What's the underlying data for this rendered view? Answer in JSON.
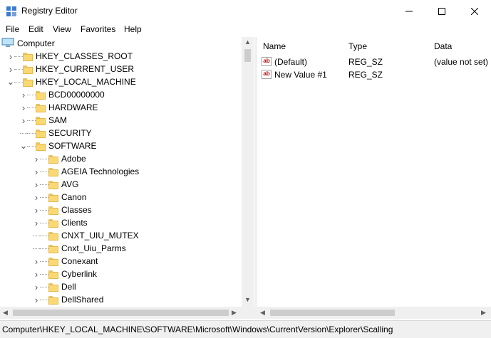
{
  "window": {
    "title": "Registry Editor"
  },
  "menu": [
    "File",
    "Edit",
    "View",
    "Favorites",
    "Help"
  ],
  "tree": [
    {
      "label": "Computer",
      "level": 0,
      "expander": "none",
      "icon": "computer-icon"
    },
    {
      "label": "HKEY_CLASSES_ROOT",
      "level": 1,
      "expander": "collapsed"
    },
    {
      "label": "HKEY_CURRENT_USER",
      "level": 1,
      "expander": "collapsed"
    },
    {
      "label": "HKEY_LOCAL_MACHINE",
      "level": 1,
      "expander": "expanded"
    },
    {
      "label": "BCD00000000",
      "level": 2,
      "expander": "collapsed"
    },
    {
      "label": "HARDWARE",
      "level": 2,
      "expander": "collapsed"
    },
    {
      "label": "SAM",
      "level": 2,
      "expander": "collapsed"
    },
    {
      "label": "SECURITY",
      "level": 2,
      "expander": "none"
    },
    {
      "label": "SOFTWARE",
      "level": 2,
      "expander": "expanded"
    },
    {
      "label": "Adobe",
      "level": 3,
      "expander": "collapsed"
    },
    {
      "label": "AGEIA Technologies",
      "level": 3,
      "expander": "collapsed"
    },
    {
      "label": "AVG",
      "level": 3,
      "expander": "collapsed"
    },
    {
      "label": "Canon",
      "level": 3,
      "expander": "collapsed"
    },
    {
      "label": "Classes",
      "level": 3,
      "expander": "collapsed"
    },
    {
      "label": "Clients",
      "level": 3,
      "expander": "collapsed"
    },
    {
      "label": "CNXT_UIU_MUTEX",
      "level": 3,
      "expander": "none"
    },
    {
      "label": "Cnxt_Uiu_Parms",
      "level": 3,
      "expander": "none"
    },
    {
      "label": "Conexant",
      "level": 3,
      "expander": "collapsed"
    },
    {
      "label": "Cyberlink",
      "level": 3,
      "expander": "collapsed"
    },
    {
      "label": "Dell",
      "level": 3,
      "expander": "collapsed"
    },
    {
      "label": "DellShared",
      "level": 3,
      "expander": "collapsed"
    }
  ],
  "columns": [
    "Name",
    "Type",
    "Data"
  ],
  "values": [
    {
      "name": "(Default)",
      "type": "REG_SZ",
      "data": "(value not set)"
    },
    {
      "name": "New Value #1",
      "type": "REG_SZ",
      "data": ""
    }
  ],
  "status": "Computer\\HKEY_LOCAL_MACHINE\\SOFTWARE\\Microsoft\\Windows\\CurrentVersion\\Explorer\\Scalling"
}
